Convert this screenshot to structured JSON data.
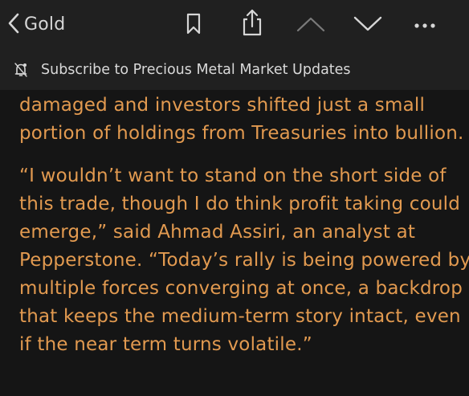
{
  "nav": {
    "back_label": "Gold",
    "icons": [
      "chevron-left-icon",
      "bookmark-icon",
      "share-icon",
      "chevron-up-icon",
      "chevron-down-icon",
      "more-icon"
    ]
  },
  "subscribe": {
    "label": "Subscribe to Precious Metal Market Updates",
    "icon": "bell-icon"
  },
  "article": {
    "paragraphs": [
      {
        "lines": [
          "damaged and investors shifted just a small",
          "portion of holdings from Treasuries into bullion."
        ]
      },
      {
        "lines": [
          "“I wouldn’t want to stand on the short side of",
          "this trade, though I do think profit taking could",
          "emerge,” said Ahmad Assiri, an analyst at",
          "Pepperstone. “Today’s rally is being powered by",
          "multiple forces converging at once, a backdrop",
          "that keeps the medium-term story intact, even",
          "if the near term turns volatile.”"
        ]
      }
    ]
  },
  "colors": {
    "background": "#151515",
    "bar": "#202020",
    "text_accent": "#e29a50",
    "icon": "#d6d6d6"
  }
}
